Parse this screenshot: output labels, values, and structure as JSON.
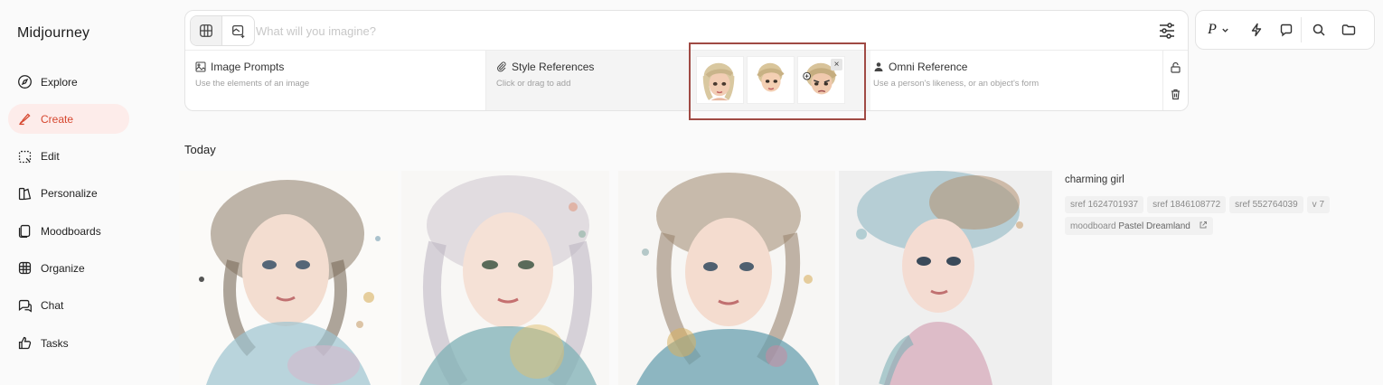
{
  "app": {
    "brand": "Midjourney"
  },
  "sidebar": {
    "items": [
      {
        "label": "Explore",
        "icon": "compass-icon"
      },
      {
        "label": "Create",
        "icon": "brush-icon",
        "active": true
      },
      {
        "label": "Edit",
        "icon": "edit-frame-icon"
      },
      {
        "label": "Personalize",
        "icon": "personalize-icon"
      },
      {
        "label": "Moodboards",
        "icon": "moodboards-icon"
      },
      {
        "label": "Organize",
        "icon": "grid-icon"
      },
      {
        "label": "Chat",
        "icon": "chat-icon"
      },
      {
        "label": "Tasks",
        "icon": "thumbs-up-icon"
      }
    ],
    "accent": "#d6472f"
  },
  "prompt_bar": {
    "placeholder": "What will you imagine?",
    "value": ""
  },
  "references": {
    "image_prompts": {
      "title": "Image Prompts",
      "subtitle": "Use the elements of an image"
    },
    "style_references": {
      "title": "Style References",
      "subtitle": "Click or drag to add",
      "count": 3
    },
    "omni_reference": {
      "title": "Omni Reference",
      "subtitle": "Use a person's likeness, or an object's form"
    },
    "close_glyph": "×"
  },
  "toolbar": {
    "personalize_label": "P"
  },
  "feed": {
    "section_label": "Today",
    "job": {
      "prompt": "charming girl",
      "tags": [
        {
          "text": "sref 1624701937"
        },
        {
          "text": "sref 1846108772"
        },
        {
          "text": "sref 552764039"
        },
        {
          "text": "v 7"
        }
      ],
      "moodboard": {
        "prefix": "moodboard",
        "name": "Pastel Dreamland"
      }
    },
    "images": 4
  },
  "colors": {
    "highlight_border": "#a04a44",
    "active_nav_bg": "#fdecea"
  }
}
